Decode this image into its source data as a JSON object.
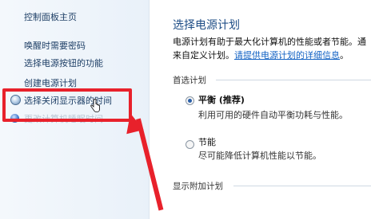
{
  "sidebar": {
    "home": "控制面板主页",
    "links": [
      "唤醒时需要密码",
      "选择电源按钮的功能",
      "创建电源计划",
      "选择关闭显示器的时间",
      "更改计算机睡眠时间"
    ]
  },
  "main": {
    "title": "选择电源计划",
    "description_text": "电源计划有助于最大化计算机的性能或者节能。通",
    "description_line2": "来自定义计划。",
    "description_link": "请提供电源计划的详细信息",
    "description_end": "。",
    "preferred_section": "首选计划",
    "plans": [
      {
        "name": "平衡 (推荐)",
        "description": "利用可用的硬件自动平衡功耗与性能。",
        "selected": true
      },
      {
        "name": "节能",
        "description": "尽可能降低计算机性能以节能。",
        "selected": false
      }
    ],
    "additional_section": "显示附加计划"
  },
  "annotation": {
    "color": "#e8212b"
  }
}
